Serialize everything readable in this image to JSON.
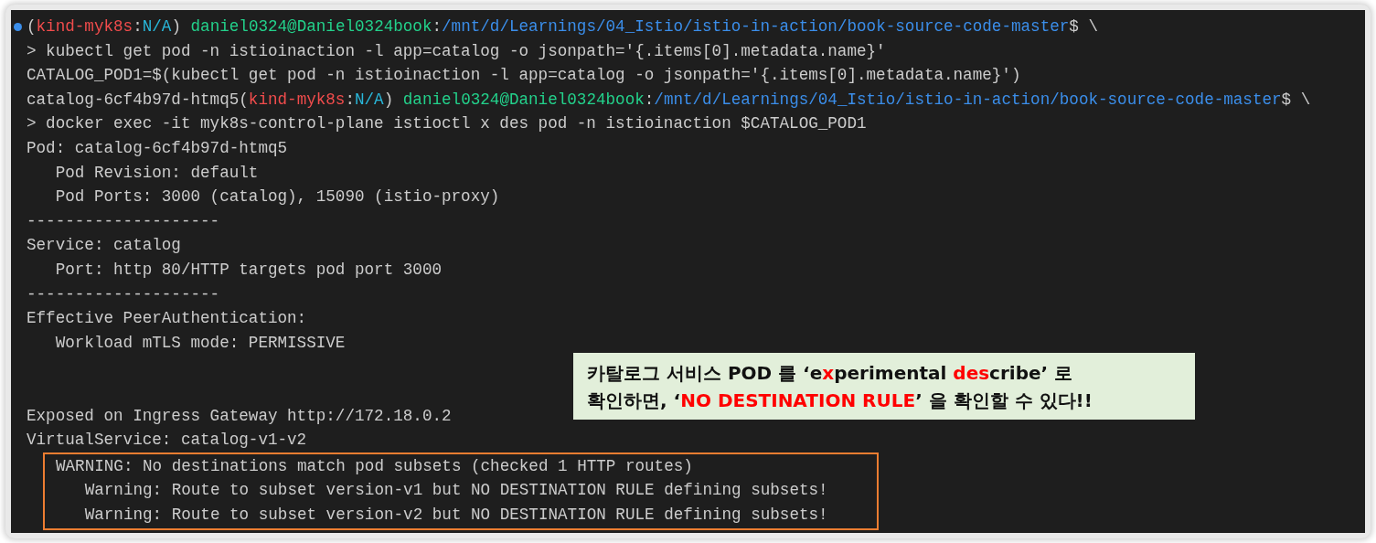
{
  "terminal": {
    "lines": [
      {
        "kind": "text",
        "marker": true,
        "segments": [
          {
            "text": "(",
            "color": "#cccccc"
          },
          {
            "text": "kind-myk8s",
            "color": "#f14c4c"
          },
          {
            "text": ":",
            "color": "#cccccc"
          },
          {
            "text": "N/A",
            "color": "#29b8db"
          },
          {
            "text": ") ",
            "color": "#cccccc"
          },
          {
            "text": "daniel0324@Daniel0324book",
            "color": "#23d18b"
          },
          {
            "text": ":",
            "color": "#cccccc"
          },
          {
            "text": "/mnt/d/Learnings/04_Istio/istio-in-action/book-source-code-master",
            "color": "#3b8eea"
          },
          {
            "text": "$ \\",
            "color": "#cccccc"
          }
        ]
      },
      {
        "kind": "text",
        "marker": false,
        "segments": [
          {
            "text": "> kubectl get pod -n istioinaction -l app=catalog -o jsonpath='{.items[0].metadata.name}'",
            "color": "#cccccc"
          }
        ]
      },
      {
        "kind": "text",
        "marker": false,
        "segments": [
          {
            "text": "CATALOG_POD1=$(kubectl get pod -n istioinaction -l app=catalog -o jsonpath='{.items[0].metadata.name}')",
            "color": "#cccccc"
          }
        ]
      },
      {
        "kind": "text",
        "marker": false,
        "segments": [
          {
            "text": "catalog-6cf4b97d-htmq5(",
            "color": "#cccccc"
          },
          {
            "text": "kind-myk8s",
            "color": "#f14c4c"
          },
          {
            "text": ":",
            "color": "#cccccc"
          },
          {
            "text": "N/A",
            "color": "#29b8db"
          },
          {
            "text": ") ",
            "color": "#cccccc"
          },
          {
            "text": "daniel0324@Daniel0324book",
            "color": "#23d18b"
          },
          {
            "text": ":",
            "color": "#cccccc"
          },
          {
            "text": "/mnt/d/Learnings/04_Istio/istio-in-action/book-source-code-master",
            "color": "#3b8eea"
          },
          {
            "text": "$ \\",
            "color": "#cccccc"
          }
        ]
      },
      {
        "kind": "text",
        "marker": false,
        "segments": [
          {
            "text": "> docker exec -it myk8s-control-plane istioctl x des pod -n istioinaction $CATALOG_POD1",
            "color": "#cccccc"
          }
        ]
      },
      {
        "kind": "text",
        "marker": false,
        "segments": [
          {
            "text": "Pod: catalog-6cf4b97d-htmq5",
            "color": "#cccccc"
          }
        ]
      },
      {
        "kind": "text",
        "marker": false,
        "segments": [
          {
            "text": "   Pod Revision: default",
            "color": "#cccccc"
          }
        ]
      },
      {
        "kind": "text",
        "marker": false,
        "segments": [
          {
            "text": "   Pod Ports: 3000 (catalog), 15090 (istio-proxy)",
            "color": "#cccccc"
          }
        ]
      },
      {
        "kind": "text",
        "marker": false,
        "segments": [
          {
            "text": "--------------------",
            "color": "#cccccc"
          }
        ]
      },
      {
        "kind": "text",
        "marker": false,
        "segments": [
          {
            "text": "Service: catalog",
            "color": "#cccccc"
          }
        ]
      },
      {
        "kind": "text",
        "marker": false,
        "segments": [
          {
            "text": "   Port: http 80/HTTP targets pod port 3000",
            "color": "#cccccc"
          }
        ]
      },
      {
        "kind": "text",
        "marker": false,
        "segments": [
          {
            "text": "--------------------",
            "color": "#cccccc"
          }
        ]
      },
      {
        "kind": "text",
        "marker": false,
        "segments": [
          {
            "text": "Effective PeerAuthentication:",
            "color": "#cccccc"
          }
        ]
      },
      {
        "kind": "text",
        "marker": false,
        "segments": [
          {
            "text": "   Workload mTLS mode: PERMISSIVE",
            "color": "#cccccc"
          }
        ]
      },
      {
        "kind": "blank"
      },
      {
        "kind": "blank"
      },
      {
        "kind": "text",
        "marker": false,
        "segments": [
          {
            "text": "Exposed on Ingress Gateway http://172.18.0.2",
            "color": "#cccccc"
          }
        ]
      },
      {
        "kind": "text",
        "marker": false,
        "segments": [
          {
            "text": "VirtualService: catalog-v1-v2",
            "color": "#cccccc"
          }
        ]
      }
    ]
  },
  "warning_block": {
    "lines": [
      "WARNING: No destinations match pod subsets (checked 1 HTTP routes)",
      "   Warning: Route to subset version-v1 but NO DESTINATION RULE defining subsets!",
      "   Warning: Route to subset version-v2 but NO DESTINATION RULE defining subsets!"
    ]
  },
  "callout": {
    "lines": [
      "카탈로그 서비스 POD 를 ‘e**x**perimental **des**cribe’ 로",
      "확인하면, ‘**NO DESTINATION RULE**’ 을 확인할 수 있다!!"
    ]
  }
}
